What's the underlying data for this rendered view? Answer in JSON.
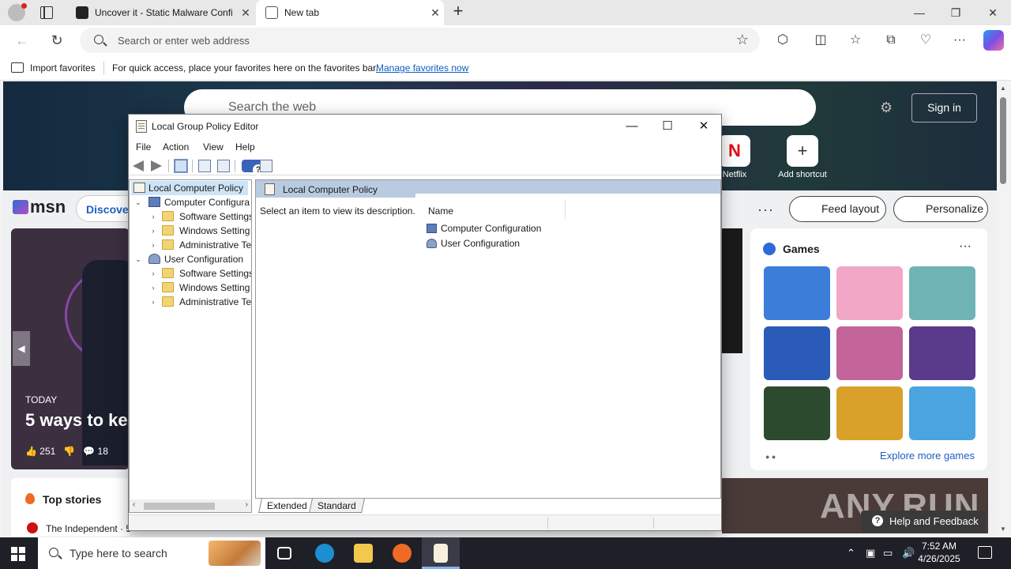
{
  "browser": {
    "tabs": [
      {
        "title": "Uncover it - Static Malware Confi",
        "close": "✕"
      },
      {
        "title": "New tab",
        "close": "✕"
      }
    ],
    "new_tab": "+",
    "window_controls": {
      "minimize": "—",
      "restore": "❐",
      "close": "✕"
    },
    "address_placeholder": "Search or enter web address",
    "favorites_bar": {
      "import_label": "Import favorites",
      "message": "For quick access, place your favorites here on the favorites bar.",
      "manage_link": "Manage favorites now"
    },
    "icons": [
      "back-icon",
      "refresh-icon",
      "favorite-star-icon",
      "extensions-icon",
      "split-screen-icon",
      "favorites-icon",
      "collections-icon",
      "performance-icon",
      "more-icon",
      "copilot-icon"
    ]
  },
  "ntp": {
    "search_placeholder": "Search the web",
    "sign_in": "Sign in",
    "shortcuts": [
      {
        "label": "Netflix",
        "glyph": "N"
      },
      {
        "label": "Add shortcut",
        "glyph": "+"
      }
    ],
    "msn_logo": "msn",
    "discover": "Discover",
    "more": "···",
    "feed_layout": "Feed layout",
    "personalize": "Personalize",
    "feature": {
      "badge": "TODAY",
      "headline": "5 ways to ke",
      "likes": "251",
      "comments": "18"
    },
    "top_stories": {
      "title": "Top stories",
      "source": "The Independent · 5"
    },
    "games": {
      "title": "Games",
      "more": "···",
      "explore": "Explore more games",
      "tile_colors": [
        "#3b7dd8",
        "#f2a7c7",
        "#6fb3b5",
        "#2a5bb8",
        "#c3649a",
        "#5a3a8a",
        "#2c4a2e",
        "#d9a12a",
        "#4aa4e0"
      ]
    },
    "help_feedback": "Help and Feedback",
    "watermark": "ANY.RUN"
  },
  "gpe": {
    "title": "Local Group Policy Editor",
    "window_controls": {
      "minimize": "—",
      "maximize": "☐",
      "close": "✕"
    },
    "menu": [
      "File",
      "Action",
      "View",
      "Help"
    ],
    "tree": {
      "root": "Local Computer Policy",
      "computer": "Computer Configura",
      "computer_children": [
        "Software Settings",
        "Windows Setting",
        "Administrative Te"
      ],
      "user": "User Configuration",
      "user_children": [
        "Software Settings",
        "Windows Setting",
        "Administrative Te"
      ],
      "expanded_glyph": "⌄",
      "collapsed_glyph": "›"
    },
    "right": {
      "header": "Local Computer Policy",
      "description": "Select an item to view its description.",
      "column_name": "Name",
      "items": [
        "Computer Configuration",
        "User Configuration"
      ]
    },
    "view_tabs": [
      "Extended",
      "Standard"
    ]
  },
  "taskbar": {
    "search_placeholder": "Type here to search",
    "time": "7:52 AM",
    "date": "4/26/2025",
    "apps": [
      "task-view",
      "edge",
      "file-explorer",
      "firefox",
      "group-policy-editor"
    ],
    "app_colors": {
      "edge": "#1b8fd1",
      "explorer": "#f2c94c",
      "firefox": "#f06a24",
      "gpe": "#f5efdc"
    }
  }
}
